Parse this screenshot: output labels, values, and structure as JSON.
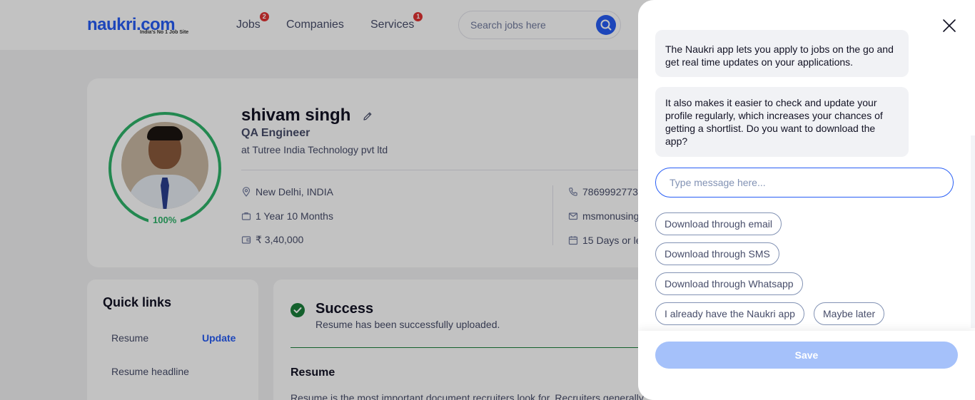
{
  "header": {
    "logo_text": "naukri.com",
    "logo_tagline": "India's No 1 Job Site",
    "nav": [
      {
        "label": "Jobs",
        "badge": "2"
      },
      {
        "label": "Companies",
        "badge": ""
      },
      {
        "label": "Services",
        "badge": "1"
      }
    ],
    "search": {
      "placeholder": "Search jobs here"
    }
  },
  "profile": {
    "name": "shivam singh",
    "role": "QA Engineer",
    "company": "at Tutree India Technology pvt ltd",
    "completion": "100%",
    "location": "New Delhi, INDIA",
    "experience": "1 Year 10 Months",
    "salary": "₹ 3,40,000",
    "phone": "7869992773",
    "email": "msmonusing",
    "notice": "15 Days or le"
  },
  "quick_links": {
    "title": "Quick links",
    "items": [
      "Resume",
      "Resume headline"
    ],
    "update_label": "Update"
  },
  "resume_section": {
    "success_title": "Success",
    "success_message": "Resume has been successfully uploaded.",
    "title": "Resume",
    "description": "Resume is the most important document recruiters look for. Recruiters generally"
  },
  "chat": {
    "messages": [
      "The Naukri app lets you apply to jobs on the go and get real time updates on your applications.",
      "It also makes it easier to check and update your profile regularly, which increases your chances of getting a shortlist. Do you want to download the app?"
    ],
    "input_placeholder": "Type message here...",
    "options": [
      "Download through email",
      "Download through SMS",
      "Download through Whatsapp",
      "I already have the Naukri app",
      "Maybe later"
    ],
    "save_label": "Save"
  },
  "colors": {
    "brand": "#275df5",
    "success": "#1a7f3b",
    "completion": "#2eb36a",
    "badge": "#e13333",
    "save_disabled": "#a5c1fa"
  }
}
